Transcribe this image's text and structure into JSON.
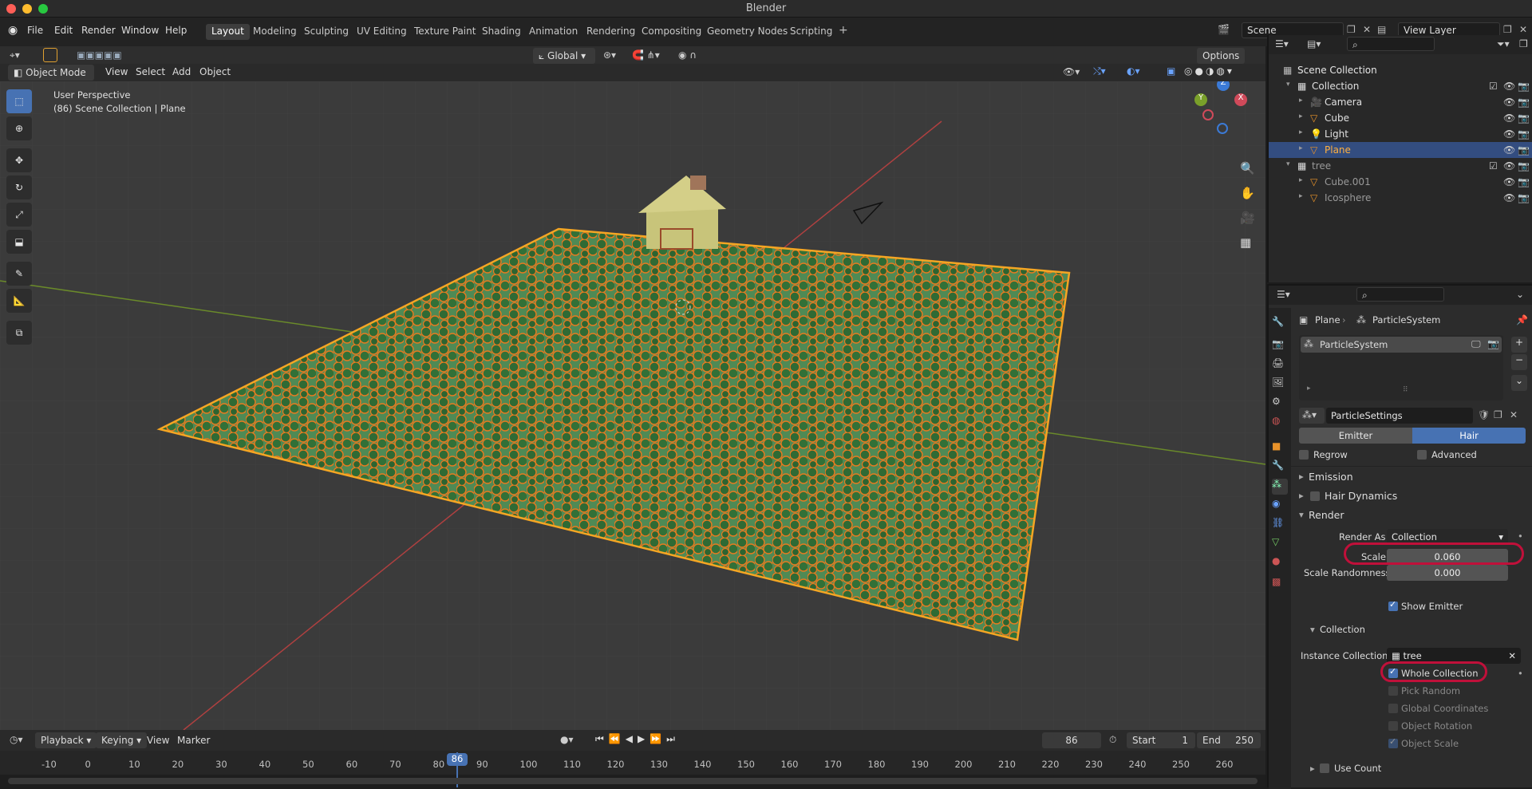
{
  "window": {
    "title": "Blender"
  },
  "menubar": {
    "items": [
      "File",
      "Edit",
      "Render",
      "Window",
      "Help"
    ],
    "workspaces": [
      "Layout",
      "Modeling",
      "Sculpting",
      "UV Editing",
      "Texture Paint",
      "Shading",
      "Animation",
      "Rendering",
      "Compositing",
      "Geometry Nodes",
      "Scripting"
    ],
    "scene": "Scene",
    "view_layer": "View Layer"
  },
  "viewport_header": {
    "orientation": "Global",
    "options": "Options",
    "mode": "Object Mode",
    "menus": [
      "View",
      "Select",
      "Add",
      "Object"
    ]
  },
  "viewport": {
    "perspective": "User Perspective",
    "context": "(86) Scene Collection | Plane",
    "gizmo_axes": [
      "Z",
      "Y",
      "X"
    ]
  },
  "outliner": {
    "root": "Scene Collection",
    "rows": [
      {
        "label": "Collection",
        "depth": 1,
        "kind": "collection"
      },
      {
        "label": "Camera",
        "depth": 2,
        "kind": "camera"
      },
      {
        "label": "Cube",
        "depth": 2,
        "kind": "mesh"
      },
      {
        "label": "Light",
        "depth": 2,
        "kind": "light"
      },
      {
        "label": "Plane",
        "depth": 2,
        "kind": "mesh",
        "selected": true
      },
      {
        "label": "tree",
        "depth": 1,
        "kind": "collection"
      },
      {
        "label": "Cube.001",
        "depth": 2,
        "kind": "mesh"
      },
      {
        "label": "Icosphere",
        "depth": 2,
        "kind": "mesh"
      }
    ]
  },
  "properties": {
    "breadcrumb_object": "Plane",
    "breadcrumb_system": "ParticleSystem",
    "system_name": "ParticleSystem",
    "settings_name": "ParticleSettings",
    "type_emitter": "Emitter",
    "type_hair": "Hair",
    "regrow": "Regrow",
    "advanced": "Advanced",
    "panel_emission": "Emission",
    "panel_hair_dynamics": "Hair Dynamics",
    "panel_render": "Render",
    "render_as_label": "Render As",
    "render_as_value": "Collection",
    "scale_label": "Scale",
    "scale_value": "0.060",
    "scale_random_label": "Scale Randomness",
    "scale_random_value": "0.000",
    "show_emitter": "Show Emitter",
    "sub_collection": "Collection",
    "instance_collection_label": "Instance Collection",
    "instance_collection_value": "tree",
    "whole_collection": "Whole Collection",
    "pick_random": "Pick Random",
    "global_coordinates": "Global Coordinates",
    "object_rotation": "Object Rotation",
    "object_scale": "Object Scale",
    "use_count": "Use Count"
  },
  "timeline": {
    "menus": [
      "Playback",
      "Keying",
      "View",
      "Marker"
    ],
    "current_frame": "86",
    "start_label": "Start",
    "start": "1",
    "end_label": "End",
    "end": "250",
    "ticks": [
      "-10",
      "0",
      "10",
      "20",
      "30",
      "40",
      "50",
      "60",
      "70",
      "80",
      "90",
      "100",
      "110",
      "120",
      "130",
      "140",
      "150",
      "160",
      "170",
      "180",
      "190",
      "200",
      "210",
      "220",
      "230",
      "240",
      "250",
      "260"
    ]
  },
  "colors": {
    "accent": "#4772b3",
    "selection_orange": "#f5a623",
    "highlight_red": "#c0103a"
  }
}
